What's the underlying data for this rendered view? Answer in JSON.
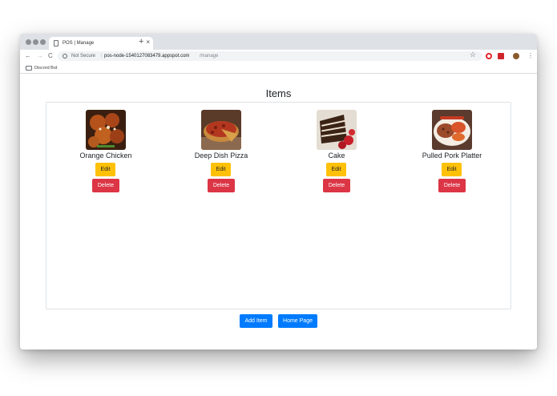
{
  "browser": {
    "tab_title": "POS | Manage",
    "tab_close": "×",
    "new_tab": "+",
    "nav_back": "←",
    "nav_forward": "→",
    "nav_reload": "C",
    "security_label": "Not Secure",
    "url_separator": "|",
    "url_host": "pos-node-1540127083479.appspot.com",
    "url_path": "/manage",
    "star": "☆",
    "menu": "⋮",
    "bookmark": "Discord Bot"
  },
  "page": {
    "title": "Items",
    "items": [
      {
        "name": "Orange Chicken",
        "edit_label": "Edit",
        "delete_label": "Delete"
      },
      {
        "name": "Deep Dish Pizza",
        "edit_label": "Edit",
        "delete_label": "Delete"
      },
      {
        "name": "Cake",
        "edit_label": "Edit",
        "delete_label": "Delete"
      },
      {
        "name": "Pulled Pork Platter",
        "edit_label": "Edit",
        "delete_label": "Delete"
      }
    ],
    "add_item_label": "Add Item",
    "home_page_label": "Home Page"
  },
  "colors": {
    "primary": "#007bff",
    "warning": "#ffc107",
    "danger": "#dc3545",
    "titlebar": "#dee1e6"
  },
  "icons": [
    "page-icon",
    "info-icon",
    "star-icon",
    "opera-icon",
    "extension-icon",
    "profile-icon",
    "menu-icon",
    "folder-icon"
  ]
}
